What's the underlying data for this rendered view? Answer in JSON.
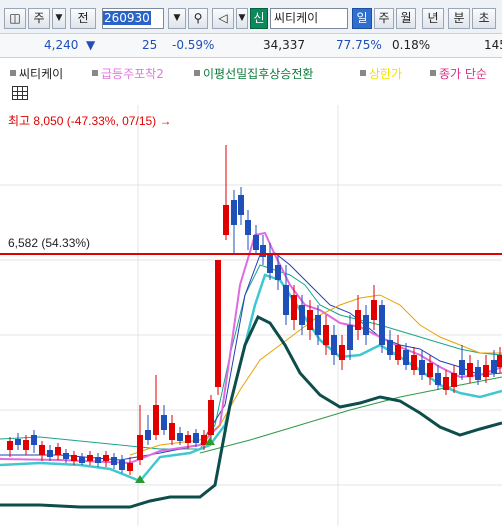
{
  "toolbar": {
    "app_icon": "window-icon",
    "type_label": "주",
    "mode_label": "전",
    "stock_code": "260930",
    "new_badge": "신",
    "stock_name": "씨티케이",
    "periods": [
      "일",
      "주",
      "월",
      "년",
      "분",
      "초"
    ],
    "selected_period": "일"
  },
  "quote": {
    "price": "4,240",
    "direction_arrow": "▼",
    "change": "25",
    "change_pct": "-0.59%",
    "volume": "34,337",
    "ratio": "77.75%",
    "turnover": "0.18%",
    "extra": "145"
  },
  "legend": [
    {
      "label": "씨티케이",
      "color": "#222222"
    },
    {
      "label": "급등주포착2",
      "color": "#e07ae0"
    },
    {
      "label": "이평선밀집후상승전환",
      "color": "#0b7a3b"
    },
    {
      "label": "상한가",
      "color": "#f2e200"
    },
    {
      "label": "종가 단순",
      "color": "#d63384"
    }
  ],
  "chart": {
    "high_annotation": "최고 8,050 (-47.33%, 07/15) →",
    "price_line_label": "6,582 (54.33%)",
    "price_line_color": "#e00000",
    "up_color": "#e00000",
    "down_color": "#1f4fb8"
  }
}
